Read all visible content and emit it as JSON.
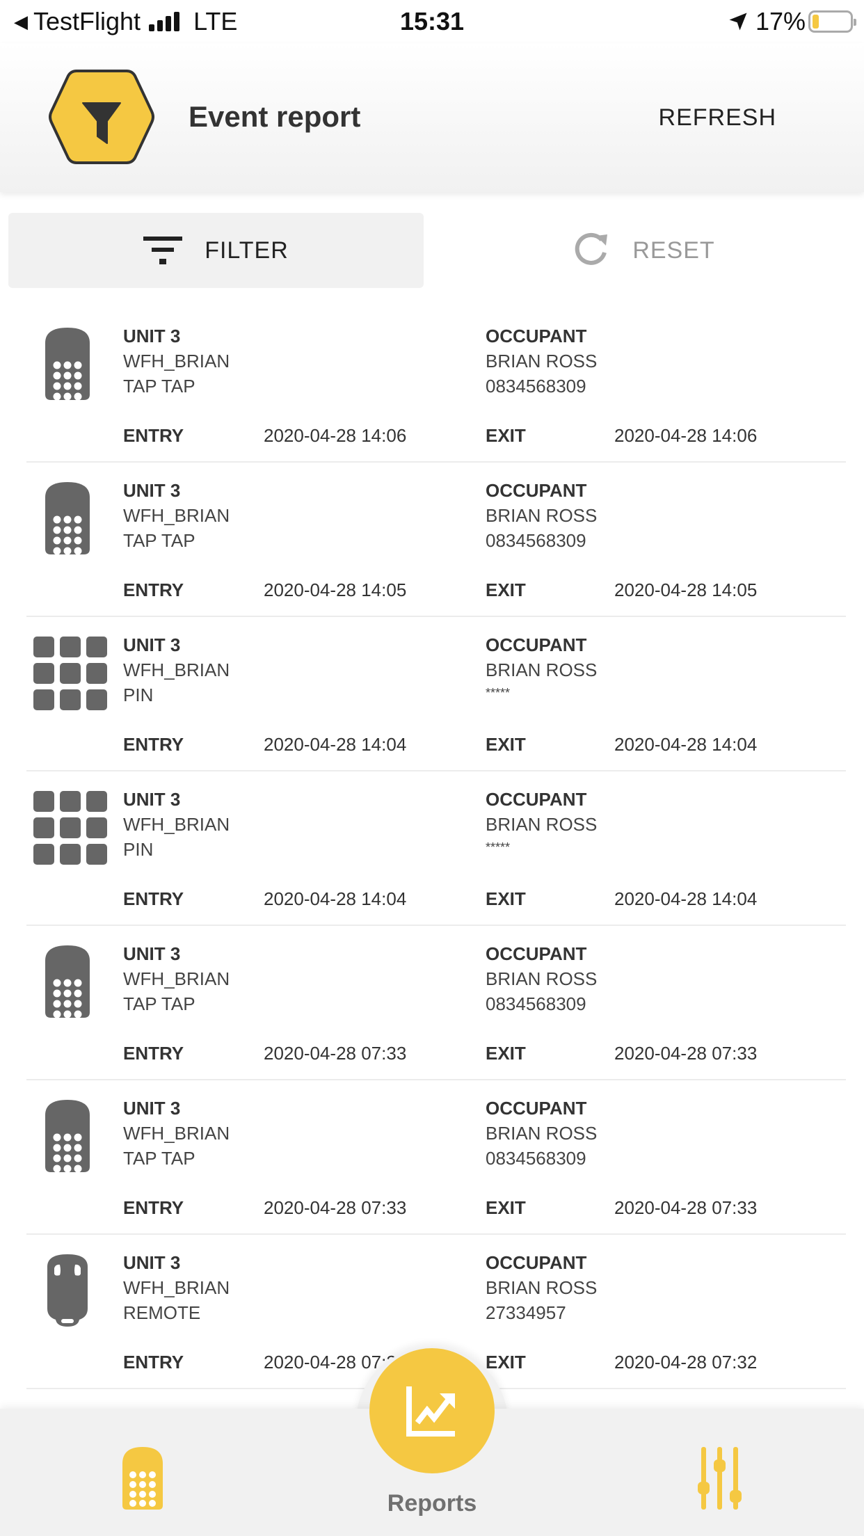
{
  "status_bar": {
    "back_app": "TestFlight",
    "network": "LTE",
    "time": "15:31",
    "battery": "17%",
    "battery_level": 0.17
  },
  "header": {
    "logo_icon": "funnel-hexagon-logo",
    "title": "Event report",
    "refresh_label": "REFRESH"
  },
  "toolbar": {
    "filter_label": "FILTER",
    "filter_icon": "filter-lines-icon",
    "reset_label": "RESET",
    "reset_icon": "refresh-arrow-icon"
  },
  "colors": {
    "accent": "#f5c842",
    "icon_gray": "#666666",
    "text": "#333333",
    "muted": "#999999"
  },
  "events": [
    {
      "device": "keypad-remote",
      "unit": "UNIT 3",
      "name": "WFH_BRIAN",
      "method": "TAP TAP",
      "occupant_label": "OCCUPANT",
      "occupant": "BRIAN ROSS",
      "credential": "0834568309",
      "entry_label": "ENTRY",
      "entry": "2020-04-28 14:06",
      "exit_label": "EXIT",
      "exit": "2020-04-28 14:06"
    },
    {
      "device": "keypad-remote",
      "unit": "UNIT 3",
      "name": "WFH_BRIAN",
      "method": "TAP TAP",
      "occupant_label": "OCCUPANT",
      "occupant": "BRIAN ROSS",
      "credential": "0834568309",
      "entry_label": "ENTRY",
      "entry": "2020-04-28 14:05",
      "exit_label": "EXIT",
      "exit": "2020-04-28 14:05"
    },
    {
      "device": "pin-keypad",
      "unit": "UNIT 3",
      "name": "WFH_BRIAN",
      "method": "PIN",
      "occupant_label": "OCCUPANT",
      "occupant": "BRIAN ROSS",
      "credential": "*****",
      "entry_label": "ENTRY",
      "entry": "2020-04-28 14:04",
      "exit_label": "EXIT",
      "exit": "2020-04-28 14:04"
    },
    {
      "device": "pin-keypad",
      "unit": "UNIT 3",
      "name": "WFH_BRIAN",
      "method": "PIN",
      "occupant_label": "OCCUPANT",
      "occupant": "BRIAN ROSS",
      "credential": "*****",
      "entry_label": "ENTRY",
      "entry": "2020-04-28 14:04",
      "exit_label": "EXIT",
      "exit": "2020-04-28 14:04"
    },
    {
      "device": "keypad-remote",
      "unit": "UNIT 3",
      "name": "WFH_BRIAN",
      "method": "TAP TAP",
      "occupant_label": "OCCUPANT",
      "occupant": "BRIAN ROSS",
      "credential": "0834568309",
      "entry_label": "ENTRY",
      "entry": "2020-04-28 07:33",
      "exit_label": "EXIT",
      "exit": "2020-04-28 07:33"
    },
    {
      "device": "keypad-remote",
      "unit": "UNIT 3",
      "name": "WFH_BRIAN",
      "method": "TAP TAP",
      "occupant_label": "OCCUPANT",
      "occupant": "BRIAN ROSS",
      "credential": "0834568309",
      "entry_label": "ENTRY",
      "entry": "2020-04-28 07:33",
      "exit_label": "EXIT",
      "exit": "2020-04-28 07:33"
    },
    {
      "device": "key-fob-remote",
      "unit": "UNIT 3",
      "name": "WFH_BRIAN",
      "method": "REMOTE",
      "occupant_label": "OCCUPANT",
      "occupant": "BRIAN ROSS",
      "credential": "27334957",
      "entry_label": "ENTRY",
      "entry": "2020-04-28 07:32",
      "exit_label": "EXIT",
      "exit": "2020-04-28 07:32"
    }
  ],
  "tab_bar": {
    "left_icon": "keypad-remote-icon",
    "center_icon": "chart-trend-icon",
    "center_label": "Reports",
    "right_icon": "sliders-icon"
  }
}
